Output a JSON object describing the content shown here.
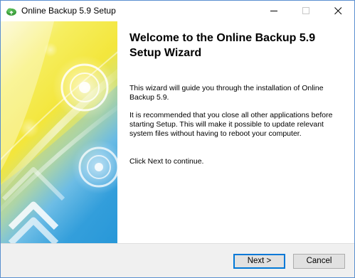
{
  "window": {
    "title": "Online Backup 5.9 Setup"
  },
  "icons": {
    "app": "app-icon",
    "minimize": "minimize-icon",
    "maximize": "maximize-icon",
    "close": "close-icon"
  },
  "colors": {
    "window_border": "#5a8fd0",
    "bottom_bar": "#f0f0f0",
    "default_button_border": "#0078d7",
    "banner_yellow": "#f6ec4a",
    "banner_blue": "#2fa0dc"
  },
  "content": {
    "heading": "Welcome to the Online Backup 5.9 Setup Wizard",
    "paragraph1": "This wizard will guide you through the installation of Online Backup 5.9.",
    "paragraph2": "It is recommended that you close all other applications before starting Setup. This will make it possible to update relevant system files without having to reboot your computer.",
    "paragraph3": "Click Next to continue."
  },
  "buttons": {
    "next": "Next >",
    "cancel": "Cancel"
  }
}
